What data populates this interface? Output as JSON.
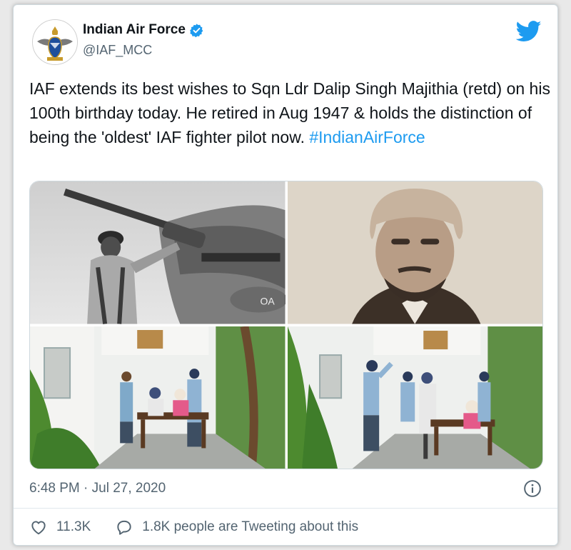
{
  "account": {
    "name": "Indian Air Force",
    "handle": "@IAF_MCC"
  },
  "tweet": {
    "text": "IAF extends its best wishes to Sqn Ldr Dalip Singh Majithia (retd) on his 100th birthday today. He retired in Aug 1947 & holds the distinction of being the 'oldest' IAF fighter pilot now. ",
    "hashtag": "#IndianAirForce"
  },
  "media": {
    "photo_overlay_text": "OA"
  },
  "meta": {
    "timestamp": "6:48 PM · Jul 27, 2020"
  },
  "actions": {
    "likes": "11.3K",
    "tweeting": "1.8K people are Tweeting about this"
  },
  "colors": {
    "link": "#1d9bf0",
    "text": "#0f1419",
    "secondary": "#536471"
  },
  "icons": [
    "iaf-emblem-icon",
    "verified-badge-icon",
    "twitter-bird-icon",
    "info-icon",
    "heart-icon",
    "comment-icon"
  ]
}
